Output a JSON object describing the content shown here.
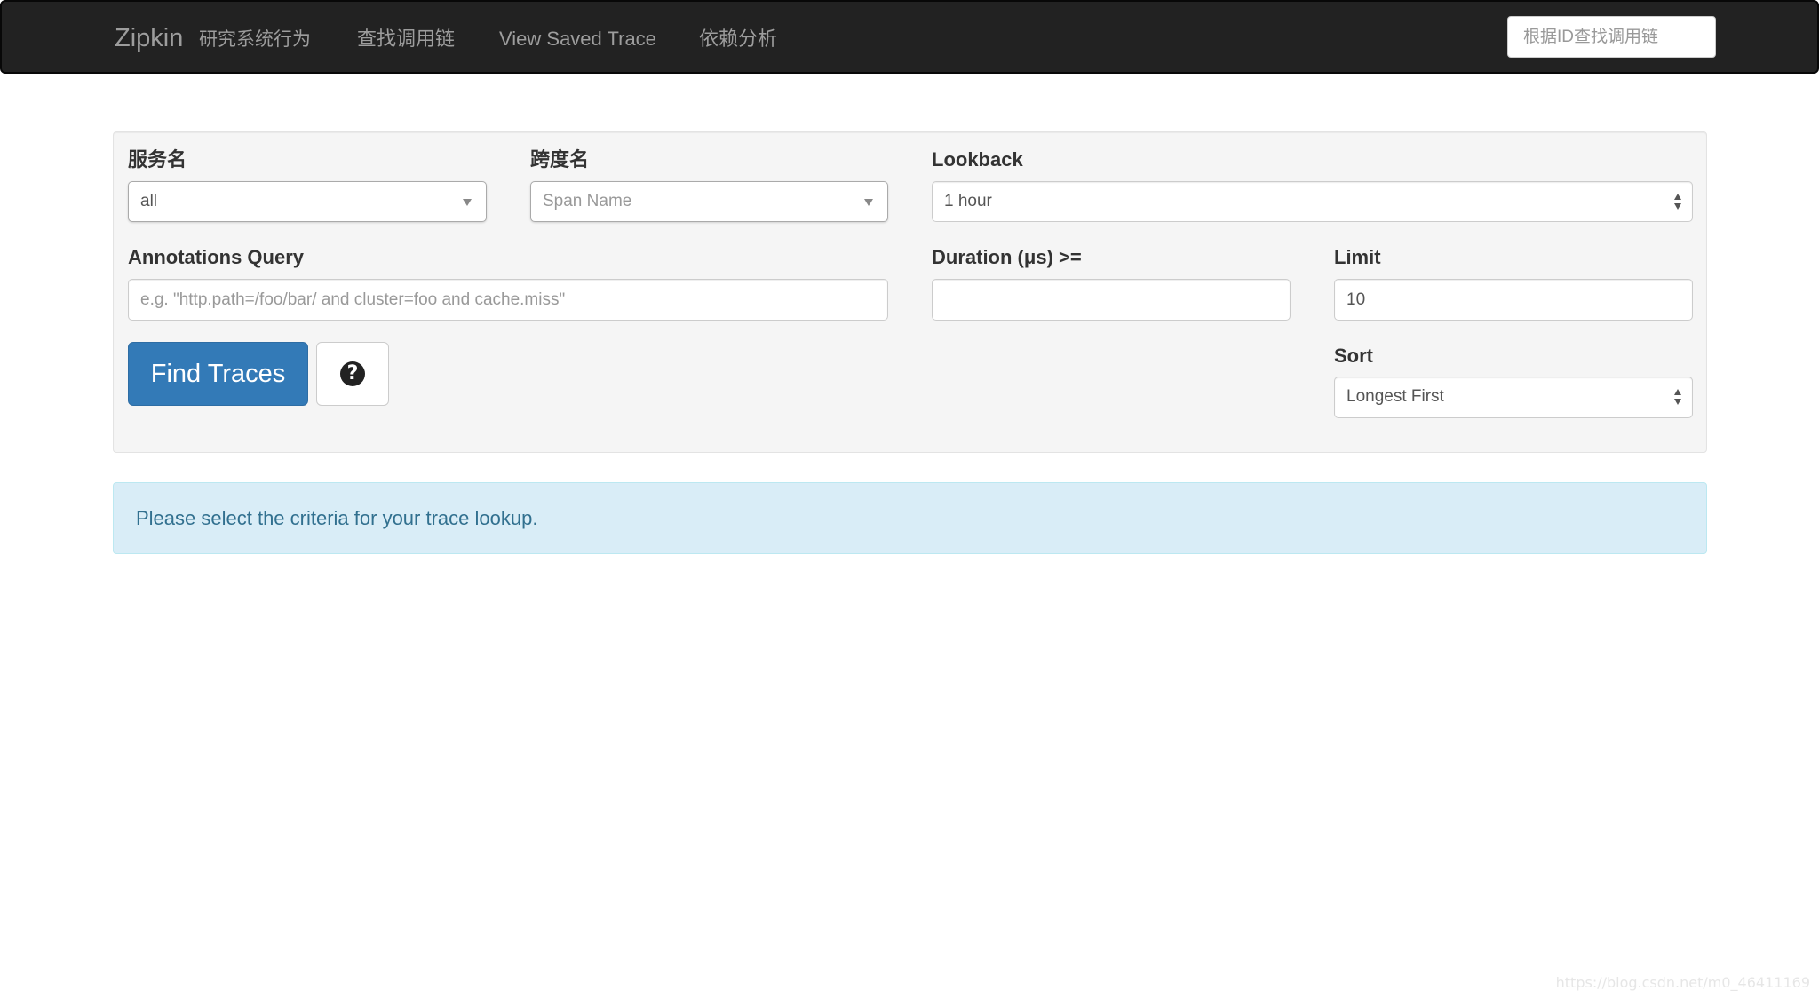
{
  "navbar": {
    "brand": "Zipkin",
    "subtitle": "研究系统行为",
    "links": [
      "查找调用链",
      "View Saved Trace",
      "依赖分析"
    ],
    "search_placeholder": "根据ID查找调用链"
  },
  "form": {
    "service": {
      "label": "服务名",
      "value": "all"
    },
    "span": {
      "label": "跨度名",
      "placeholder": "Span Name"
    },
    "lookback": {
      "label": "Lookback",
      "value": "1 hour"
    },
    "annotations": {
      "label": "Annotations Query",
      "placeholder": "e.g. \"http.path=/foo/bar/ and cluster=foo and cache.miss\""
    },
    "duration": {
      "label": "Duration (μs) >=",
      "value": ""
    },
    "limit": {
      "label": "Limit",
      "value": "10"
    },
    "sort": {
      "label": "Sort",
      "value": "Longest First"
    },
    "find_button": "Find Traces",
    "help_icon_glyph": "?"
  },
  "alert": {
    "message": "Please select the criteria for your trace lookup."
  },
  "watermark": "https://blog.csdn.net/m0_46411169",
  "colors": {
    "navbar_bg": "#222222",
    "primary": "#337ab7",
    "alert_bg": "#d9edf7",
    "alert_text": "#31708f"
  }
}
